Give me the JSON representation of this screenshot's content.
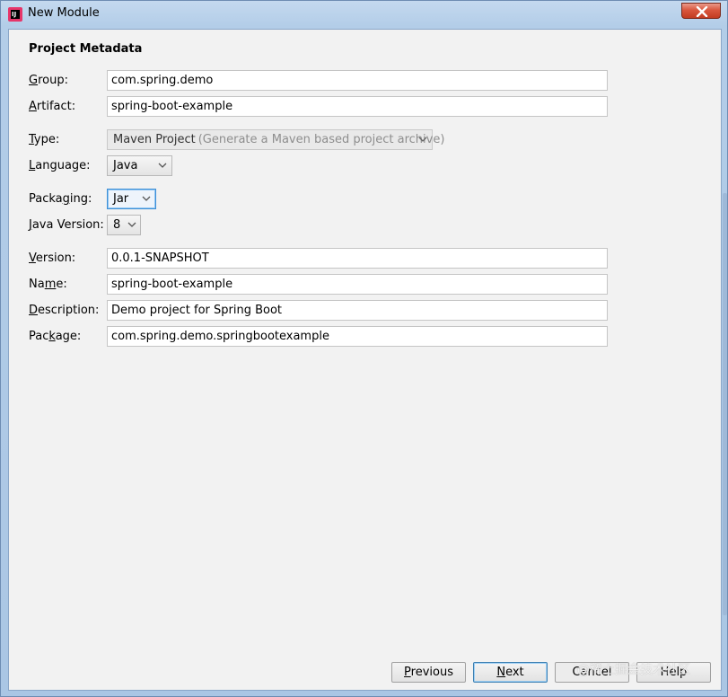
{
  "window": {
    "title": "New Module",
    "app_icon_text": "IJ"
  },
  "section_title": "Project Metadata",
  "fields": {
    "group": {
      "label_mnemonic": "G",
      "label_rest": "roup:",
      "value": "com.spring.demo"
    },
    "artifact": {
      "label_mnemonic": "A",
      "label_rest": "rtifact:",
      "value": "spring-boot-example"
    },
    "type": {
      "label_mnemonic": "T",
      "label_rest": "ype:",
      "value": "Maven Project",
      "hint": "(Generate a Maven based project archive)"
    },
    "language": {
      "label_mnemonic": "L",
      "label_rest": "anguage:",
      "value": "Java"
    },
    "packaging": {
      "label_before": "Packa",
      "label_mnemonic": "g",
      "label_rest": "ing:",
      "value": "Jar"
    },
    "java_version": {
      "label_mnemonic": "J",
      "label_rest": "ava Version:",
      "value": "8"
    },
    "version": {
      "label_mnemonic": "V",
      "label_rest": "ersion:",
      "value": "0.0.1-SNAPSHOT"
    },
    "name": {
      "label_before": "Na",
      "label_mnemonic": "m",
      "label_rest": "e:",
      "value": "spring-boot-example"
    },
    "description": {
      "label_mnemonic": "D",
      "label_rest": "escription:",
      "value": "Demo project for Spring Boot"
    },
    "package": {
      "label_before": "Pac",
      "label_mnemonic": "k",
      "label_rest": "age:",
      "value": "com.spring.demo.springbootexample"
    }
  },
  "buttons": {
    "previous": {
      "mnemonic": "P",
      "rest": "revious"
    },
    "next": {
      "mnemonic": "N",
      "rest": "ext"
    },
    "cancel": {
      "label": "Cancel"
    },
    "help": {
      "label": "Help"
    }
  },
  "watermark": "@稀土掘金技术社区",
  "colors": {
    "title_bar": "#b3cde8",
    "close_button": "#d9573e",
    "focus_border": "#3d8fd6",
    "client_bg": "#f2f2f2"
  },
  "icons": [
    "intellij-app-icon",
    "close-icon",
    "chevron-down-icon"
  ]
}
